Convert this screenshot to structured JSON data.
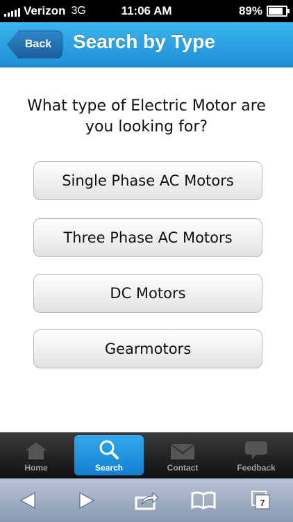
{
  "status_bar": {
    "carrier": "Verizon",
    "network": "3G",
    "time": "11:06 AM",
    "battery_percent": "89%",
    "battery_level": 0.89
  },
  "header": {
    "back_label": "Back",
    "title": "Search by Type"
  },
  "content": {
    "question_line1": "What type of Electric Motor are",
    "question_line2": "you looking for?",
    "options": [
      {
        "label": "Single Phase AC Motors"
      },
      {
        "label": "Three Phase AC Motors"
      },
      {
        "label": "DC Motors"
      },
      {
        "label": "Gearmotors"
      }
    ]
  },
  "tab_bar": {
    "tabs": [
      {
        "label": "Home",
        "icon": "home-icon"
      },
      {
        "label": "Search",
        "icon": "search-icon",
        "active": true
      },
      {
        "label": "Contact",
        "icon": "envelope-icon"
      },
      {
        "label": "Feedback",
        "icon": "chat-bubble-icon"
      }
    ]
  },
  "browser_bar": {
    "tab_count": "7"
  },
  "colors": {
    "header_blue": "#2a9fe3",
    "active_tab_blue": "#1e8fd6",
    "tab_bar_dark": "#1a1a1a",
    "browser_bar": "#9faac0"
  }
}
